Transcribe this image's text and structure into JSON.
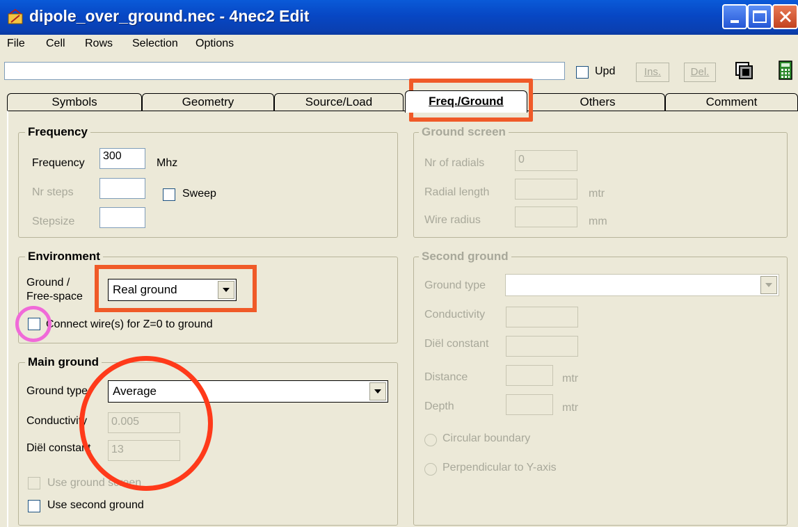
{
  "window": {
    "title": "dipole_over_ground.nec - 4nec2 Edit"
  },
  "menu": [
    "File",
    "Cell",
    "Rows",
    "Selection",
    "Options"
  ],
  "toolbar": {
    "input_value": "",
    "upd_label": "Upd",
    "ins_label": "Ins.",
    "del_label": "Del."
  },
  "tabs": [
    {
      "label": "Symbols"
    },
    {
      "label": "Geometry"
    },
    {
      "label": "Source/Load"
    },
    {
      "label": "Freq./Ground",
      "active": true
    },
    {
      "label": "Others"
    },
    {
      "label": "Comment"
    }
  ],
  "frequency": {
    "title": "Frequency",
    "frequency_label": "Frequency",
    "frequency_value": "300",
    "unit": "Mhz",
    "nr_steps_label": "Nr steps",
    "nr_steps_value": "",
    "sweep_label": "Sweep",
    "stepsize_label": "Stepsize",
    "stepsize_value": ""
  },
  "environment": {
    "title": "Environment",
    "ground_label_line1": "Ground  /",
    "ground_label_line2": "Free-space",
    "ground_selected": "Real ground",
    "connect_label": "Connect wire(s) for Z=0 to ground"
  },
  "main_ground": {
    "title": "Main ground",
    "ground_type_label": "Ground type",
    "ground_type_value": "Average",
    "conductivity_label": "Conductivity",
    "conductivity_value": "0.005",
    "diel_label": "Diël constant",
    "diel_value": "13",
    "use_screen_label": "Use ground screen",
    "use_second_label": "Use second ground"
  },
  "ground_screen": {
    "title": "Ground screen",
    "radials_label": "Nr of radials",
    "radials_value": "0",
    "radial_length_label": "Radial length",
    "radial_length_unit": "mtr",
    "wire_radius_label": "Wire radius",
    "wire_radius_unit": "mm"
  },
  "second_ground": {
    "title": "Second ground",
    "ground_type_label": "Ground type",
    "conductivity_label": "Conductivity",
    "diel_label": "Diël constant",
    "distance_label": "Distance",
    "distance_unit": "mtr",
    "depth_label": "Depth",
    "depth_unit": "mtr",
    "circular_label": "Circular boundary",
    "perpendicular_label": "Perpendicular to Y-axis"
  },
  "colors": {
    "highlight": "#f05a28",
    "highlight_circle": "#ff3a1a",
    "checkbox_circle": "#f06ad8"
  }
}
